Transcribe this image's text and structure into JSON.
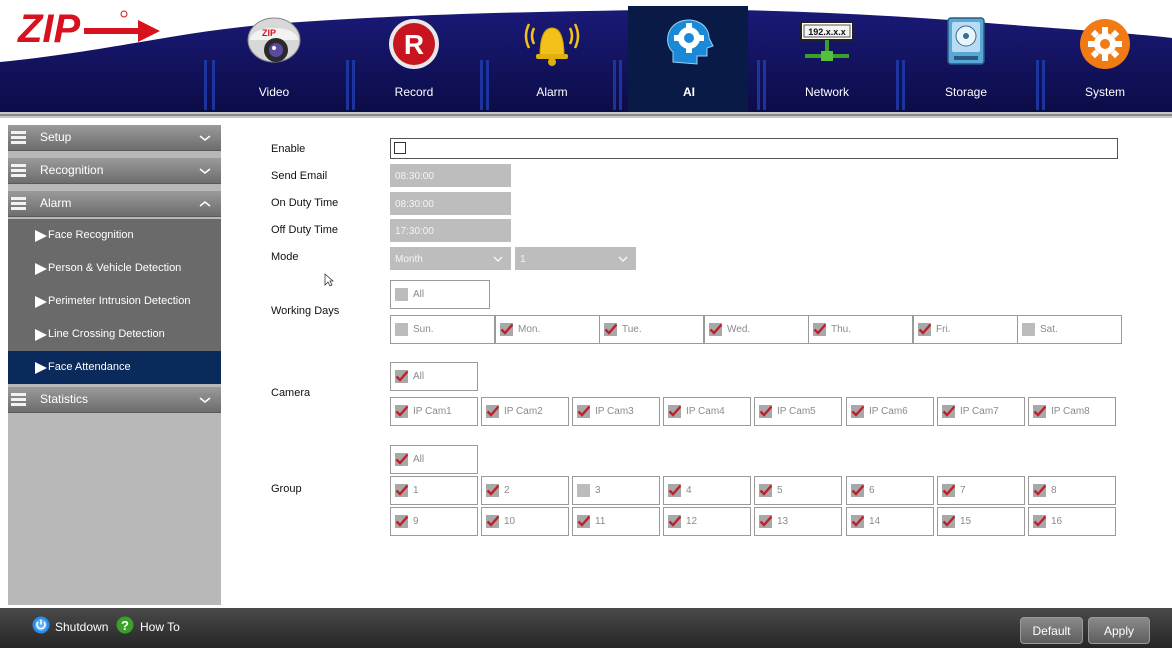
{
  "header": {
    "logo_text": "ZIP",
    "nav": [
      {
        "label": "Video",
        "icon": "camera-icon"
      },
      {
        "label": "Record",
        "icon": "record-icon"
      },
      {
        "label": "Alarm",
        "icon": "alarm-bell-icon"
      },
      {
        "label": "AI",
        "icon": "ai-head-gear-icon",
        "active": true
      },
      {
        "label": "Network",
        "icon": "network-icon"
      },
      {
        "label": "Storage",
        "icon": "hard-disk-icon"
      },
      {
        "label": "System",
        "icon": "system-gear-icon"
      }
    ],
    "network_icon_text": "192.x.x.x",
    "record_icon_text": "R"
  },
  "sidebar": {
    "categories": [
      {
        "label": "Setup",
        "expanded": false
      },
      {
        "label": "Recognition",
        "expanded": false
      },
      {
        "label": "Alarm",
        "expanded": true
      },
      {
        "label": "Statistics",
        "expanded": false
      }
    ],
    "alarm_items": [
      {
        "label": "Face Recognition"
      },
      {
        "label": "Person & Vehicle Detection"
      },
      {
        "label": "Perimeter Intrusion Detection"
      },
      {
        "label": "Line Crossing Detection"
      },
      {
        "label": "Face Attendance",
        "active": true
      }
    ]
  },
  "form": {
    "enable_label": "Enable",
    "enable_checked": false,
    "send_email_label": "Send Email",
    "send_email_value": "08:30:00",
    "on_duty_label": "On Duty Time",
    "on_duty_value": "08:30:00",
    "off_duty_label": "Off Duty Time",
    "off_duty_value": "17:30:00",
    "mode_label": "Mode",
    "mode_value": "Month",
    "mode_day_value": "1",
    "working_days_label": "Working Days",
    "working_days_all": {
      "label": "All",
      "checked": false
    },
    "working_days": [
      {
        "label": "Sun.",
        "checked": false
      },
      {
        "label": "Mon.",
        "checked": true
      },
      {
        "label": "Tue.",
        "checked": true
      },
      {
        "label": "Wed.",
        "checked": true
      },
      {
        "label": "Thu.",
        "checked": true
      },
      {
        "label": "Fri.",
        "checked": true
      },
      {
        "label": "Sat.",
        "checked": false
      }
    ],
    "camera_label": "Camera",
    "camera_all": {
      "label": "All",
      "checked": true
    },
    "cameras": [
      {
        "label": "IP Cam1",
        "checked": true
      },
      {
        "label": "IP Cam2",
        "checked": true
      },
      {
        "label": "IP Cam3",
        "checked": true
      },
      {
        "label": "IP Cam4",
        "checked": true
      },
      {
        "label": "IP Cam5",
        "checked": true
      },
      {
        "label": "IP Cam6",
        "checked": true
      },
      {
        "label": "IP Cam7",
        "checked": true
      },
      {
        "label": "IP Cam8",
        "checked": true
      }
    ],
    "group_label": "Group",
    "group_all": {
      "label": "All",
      "checked": true
    },
    "groups": [
      {
        "label": "1",
        "checked": true
      },
      {
        "label": "2",
        "checked": true
      },
      {
        "label": "3",
        "checked": false
      },
      {
        "label": "4",
        "checked": true
      },
      {
        "label": "5",
        "checked": true
      },
      {
        "label": "6",
        "checked": true
      },
      {
        "label": "7",
        "checked": true
      },
      {
        "label": "8",
        "checked": true
      },
      {
        "label": "9",
        "checked": true
      },
      {
        "label": "10",
        "checked": true
      },
      {
        "label": "11",
        "checked": true
      },
      {
        "label": "12",
        "checked": true
      },
      {
        "label": "13",
        "checked": true
      },
      {
        "label": "14",
        "checked": true
      },
      {
        "label": "15",
        "checked": true
      },
      {
        "label": "16",
        "checked": true
      }
    ]
  },
  "bottombar": {
    "shutdown_label": "Shutdown",
    "howto_label": "How To",
    "default_label": "Default",
    "apply_label": "Apply"
  },
  "colors": {
    "header_navy": "#10105a",
    "active_tab": "#0b1a4a",
    "sidebar_active": "#0b2a5c",
    "check_red": "#c0202a"
  }
}
